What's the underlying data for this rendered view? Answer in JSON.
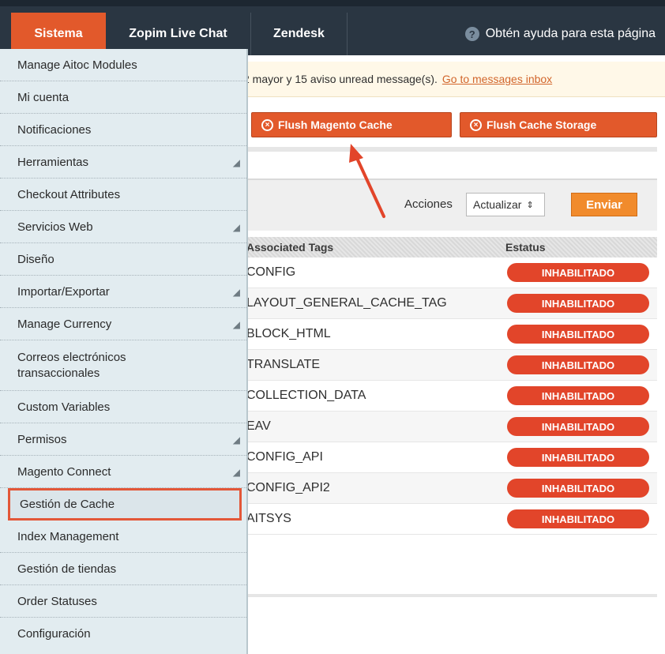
{
  "nav": {
    "tabs": [
      "Sistema",
      "Zopim Live Chat",
      "Zendesk"
    ],
    "help_label": "Obtén ayuda para esta página",
    "accent_color": "#e2592b"
  },
  "notice": {
    "text": "2 mayor y 15 aviso unread message(s).",
    "link": "Go to messages inbox"
  },
  "buttons": {
    "flush_magento": "Flush Magento Cache",
    "flush_storage": "Flush Cache Storage"
  },
  "actions": {
    "label": "Acciones",
    "select_value": "Actualizar",
    "submit": "Enviar"
  },
  "table": {
    "headers": [
      "Associated Tags",
      "Estatus"
    ],
    "rows": [
      {
        "tag": "CONFIG",
        "status": "INHABILITADO"
      },
      {
        "tag": "LAYOUT_GENERAL_CACHE_TAG",
        "status": "INHABILITADO"
      },
      {
        "tag": "BLOCK_HTML",
        "status": "INHABILITADO"
      },
      {
        "tag": "TRANSLATE",
        "status": "INHABILITADO"
      },
      {
        "tag": "COLLECTION_DATA",
        "status": "INHABILITADO"
      },
      {
        "tag": "EAV",
        "status": "INHABILITADO"
      },
      {
        "tag": "CONFIG_API",
        "status": "INHABILITADO"
      },
      {
        "tag": "CONFIG_API2",
        "status": "INHABILITADO"
      },
      {
        "tag": "AITSYS",
        "status": "INHABILITADO"
      }
    ]
  },
  "menu": {
    "items": [
      "Manage Aitoc Modules",
      "Mi cuenta",
      "Notificaciones",
      "Herramientas",
      "Checkout Attributes",
      "Servicios Web",
      "Diseño",
      "Importar/Exportar",
      "Manage Currency",
      "Correos electrónicos transaccionales",
      "Custom Variables",
      "Permisos",
      "Magento Connect",
      "Gestión de Cache",
      "Index Management",
      "Gestión de tiendas",
      "Order Statuses",
      "Configuración"
    ],
    "active": "Gestión de Cache"
  }
}
